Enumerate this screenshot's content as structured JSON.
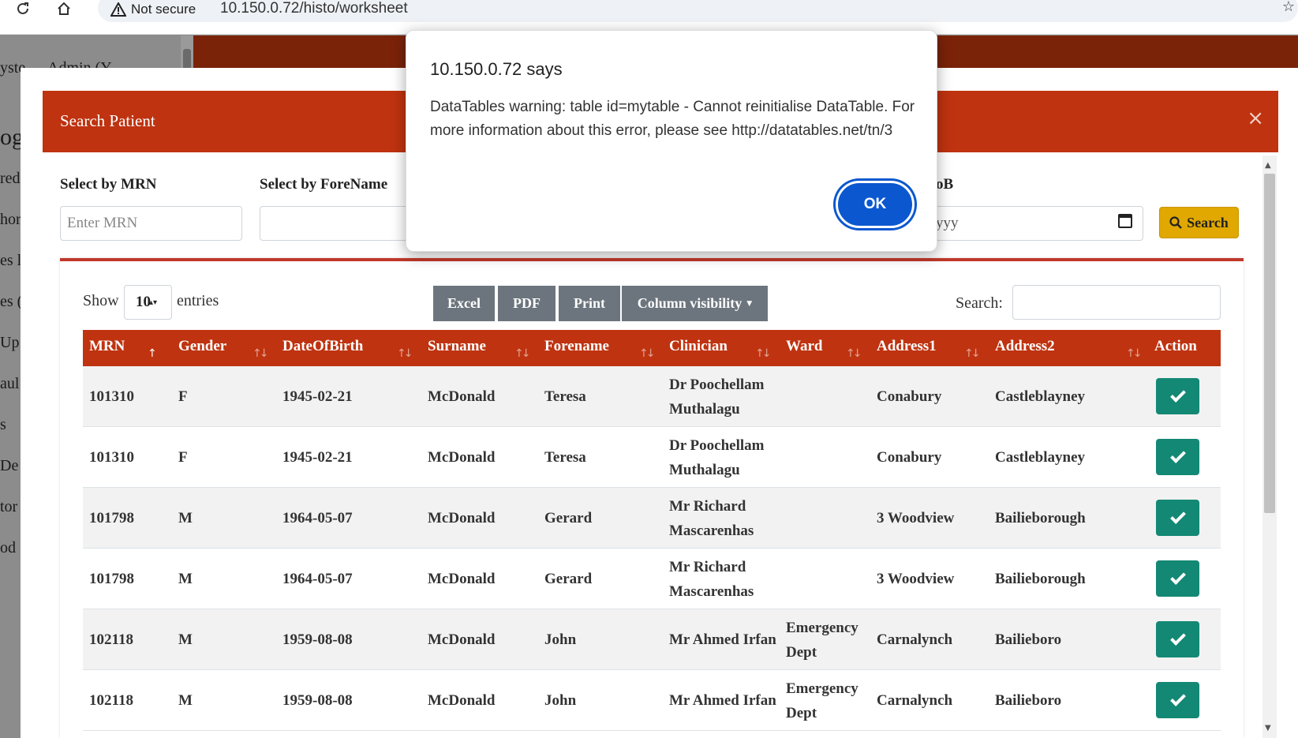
{
  "browser": {
    "security_label": "Not secure",
    "url": "10.150.0.72/histo/worksheet"
  },
  "background_fragments": [
    "yste",
    "Admin (Y",
    "og",
    "red",
    "hor",
    "es l",
    "es (",
    "Up",
    "aul",
    "s",
    "De",
    "tor",
    "od"
  ],
  "modal": {
    "title": "Search Patient",
    "close_symbol": "×",
    "filters": {
      "mrn_label": "Select by MRN",
      "mrn_placeholder": "Enter MRN",
      "forename_label": "Select by ForeName",
      "dob_label_visible": "oB",
      "dob_value_visible": "yyy",
      "search_button": "Search"
    },
    "table_controls": {
      "show_label": "Show",
      "entries_value": "10",
      "entries_label": "entries",
      "buttons": [
        "Excel",
        "PDF",
        "Print",
        "Column visibility"
      ],
      "search_label": "Search:"
    },
    "columns": [
      "MRN",
      "Gender",
      "DateOfBirth",
      "Surname",
      "Forename",
      "Clinician",
      "Ward",
      "Address1",
      "Address2",
      "Action"
    ],
    "rows": [
      {
        "mrn": "101310",
        "gender": "F",
        "dob": "1945-02-21",
        "surname": "McDonald",
        "forename": "Teresa",
        "clinician": "Dr Poochellam Muthalagu",
        "ward": "",
        "address1": "Conabury",
        "address2": "Castleblayney"
      },
      {
        "mrn": "101310",
        "gender": "F",
        "dob": "1945-02-21",
        "surname": "McDonald",
        "forename": "Teresa",
        "clinician": "Dr Poochellam Muthalagu",
        "ward": "",
        "address1": "Conabury",
        "address2": "Castleblayney"
      },
      {
        "mrn": "101798",
        "gender": "M",
        "dob": "1964-05-07",
        "surname": "McDonald",
        "forename": "Gerard",
        "clinician": "Mr Richard Mascarenhas",
        "ward": "",
        "address1": "3 Woodview",
        "address2": "Bailieborough"
      },
      {
        "mrn": "101798",
        "gender": "M",
        "dob": "1964-05-07",
        "surname": "McDonald",
        "forename": "Gerard",
        "clinician": "Mr Richard Mascarenhas",
        "ward": "",
        "address1": "3 Woodview",
        "address2": "Bailieborough"
      },
      {
        "mrn": "102118",
        "gender": "M",
        "dob": "1959-08-08",
        "surname": "McDonald",
        "forename": "John",
        "clinician": "Mr Ahmed Irfan",
        "ward": "Emergency Dept",
        "address1": "Carnalynch",
        "address2": "Bailieboro"
      },
      {
        "mrn": "102118",
        "gender": "M",
        "dob": "1959-08-08",
        "surname": "McDonald",
        "forename": "John",
        "clinician": "Mr Ahmed Irfan",
        "ward": "Emergency Dept",
        "address1": "Carnalynch",
        "address2": "Bailieboro"
      }
    ]
  },
  "alert": {
    "title": "10.150.0.72 says",
    "message": "DataTables warning: table id=mytable - Cannot reinitialise DataTable. For more information about this error, please see http://datatables.net/tn/3",
    "ok_label": "OK"
  },
  "colors": {
    "header_red": "#bf3310",
    "action_teal": "#138874",
    "search_yellow": "#e0a800",
    "button_grey": "#6c757d",
    "ok_blue": "#0b57d0"
  }
}
